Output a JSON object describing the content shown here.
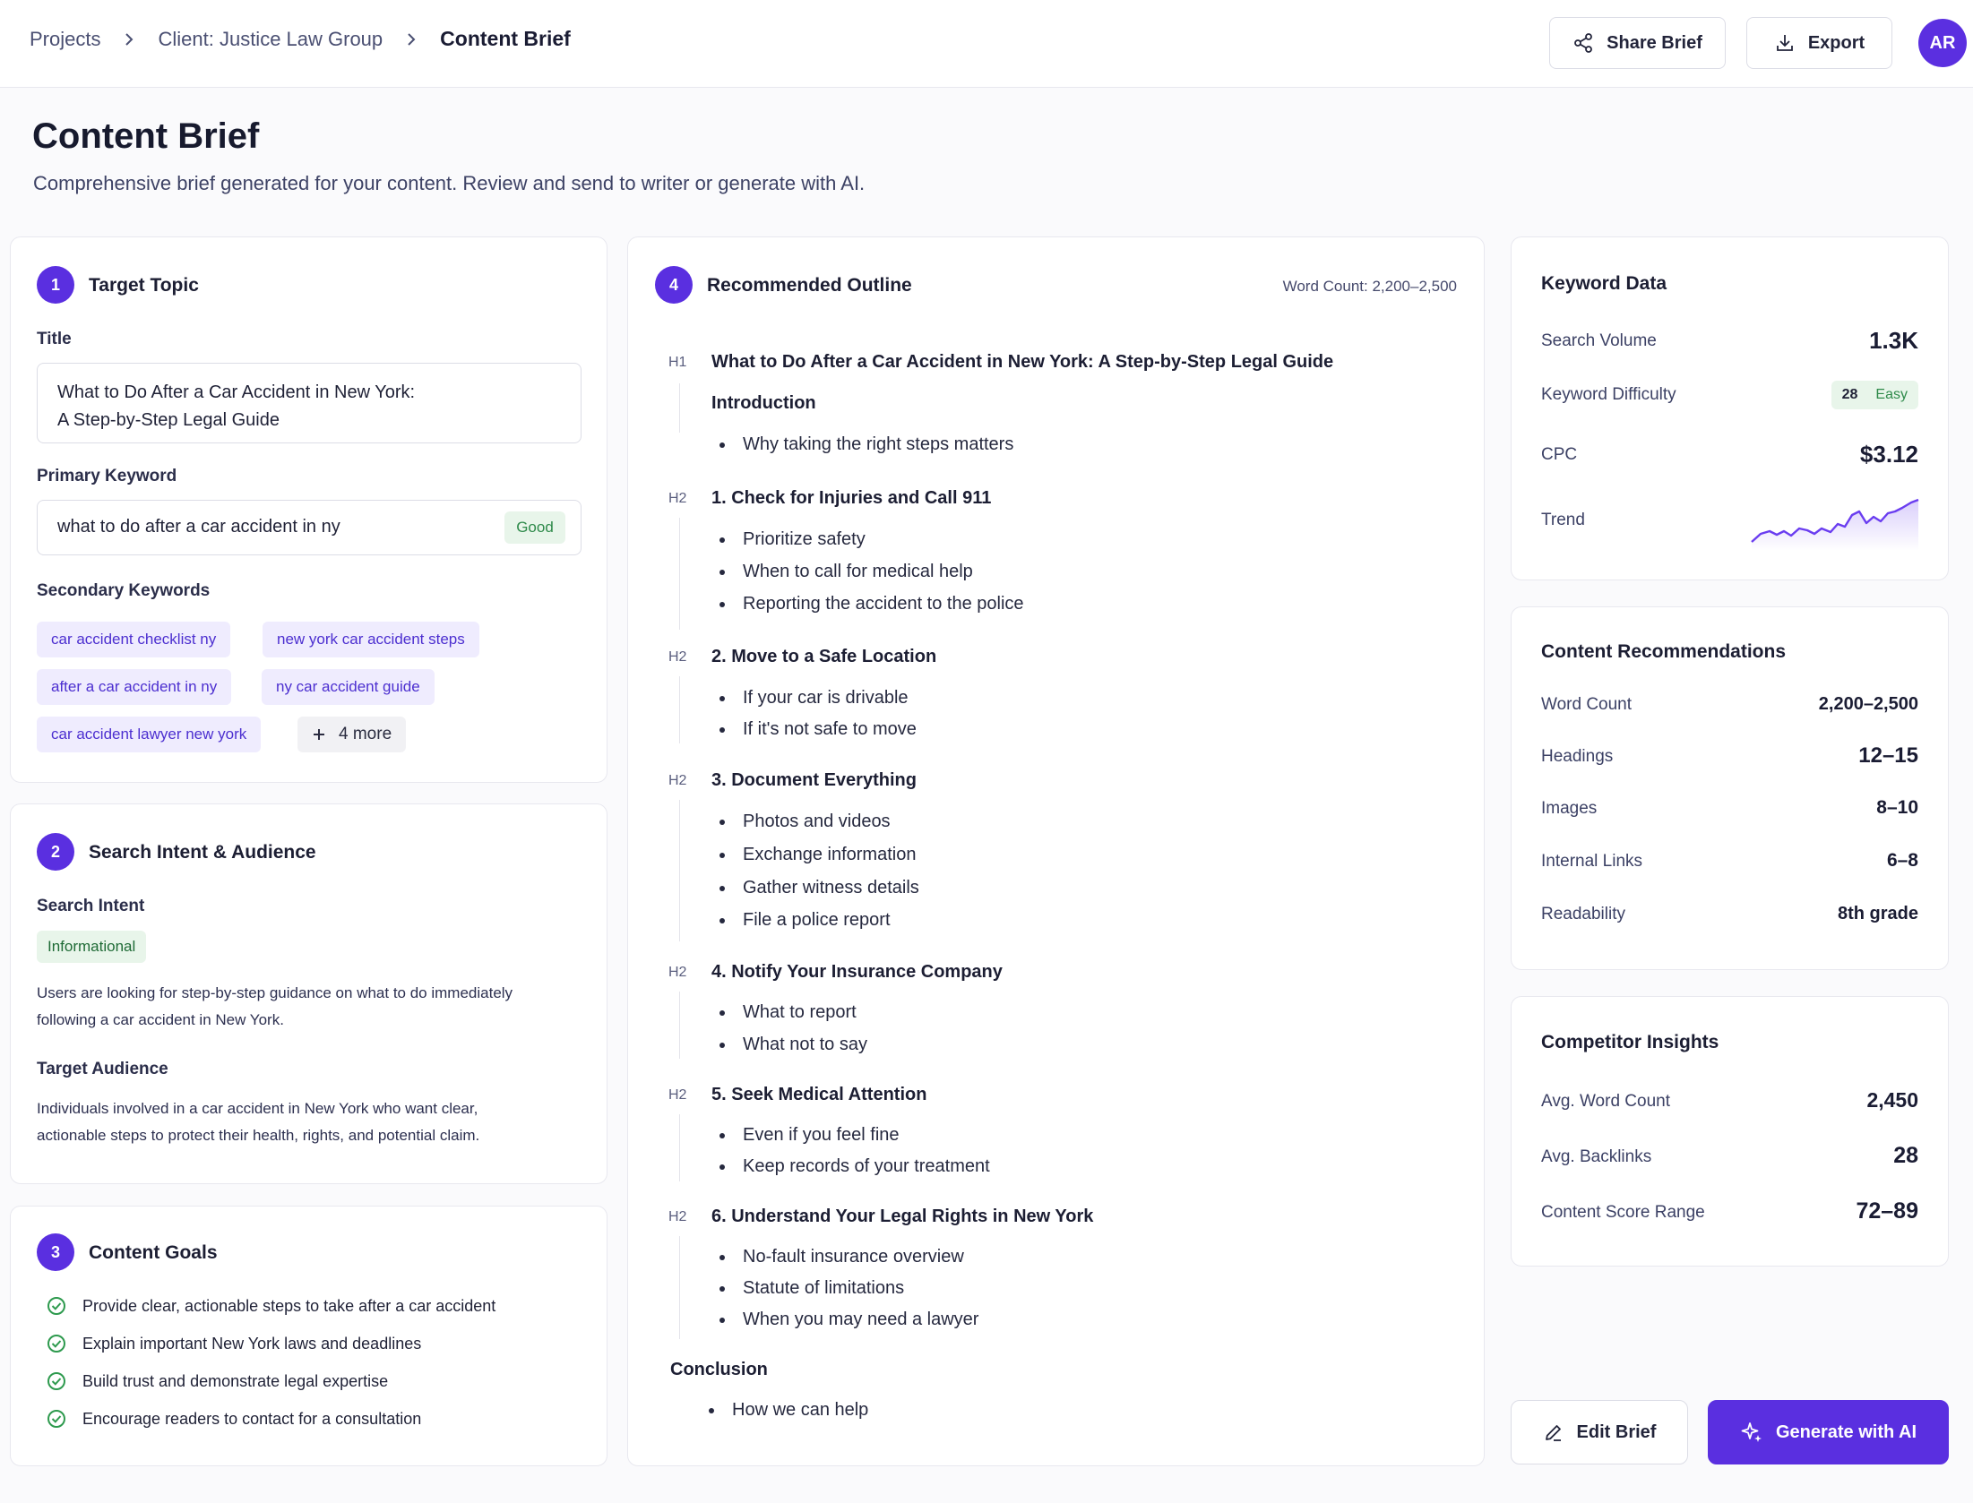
{
  "breadcrumb": {
    "items": [
      "Projects",
      "Client: Justice Law Group"
    ],
    "current": "Content Brief"
  },
  "header_actions": {
    "share_label": "Share Brief",
    "export_label": "Export",
    "avatar_initials": "AR"
  },
  "page": {
    "title": "Content Brief",
    "subtitle": "Comprehensive brief generated for your content. Review and send to writer or generate with AI."
  },
  "target_topic": {
    "number": "1",
    "heading": "Target Topic",
    "title_label": "Title",
    "title_line1": "What to Do After a Car Accident in New York:",
    "title_line2": "A Step-by-Step Legal Guide",
    "primary_label": "Primary Keyword",
    "primary_value": "what to do after a car accident in ny",
    "primary_badge": "Good",
    "secondary_label": "Secondary Keywords",
    "secondary": [
      "car accident checklist ny",
      "new york car accident steps",
      "after a car accident in ny",
      "ny car accident guide",
      "car accident lawyer new york"
    ],
    "more_label": "4 more"
  },
  "search_intent": {
    "number": "2",
    "heading": "Search Intent & Audience",
    "intent_label": "Search Intent",
    "intent_badge": "Informational",
    "intent_text_1": "Users are looking for step-by-step guidance on what to do immediately",
    "intent_text_2": "following a car accident in New York.",
    "audience_label": "Target Audience",
    "audience_text_1": "Individuals involved in a car accident in New York who want clear,",
    "audience_text_2": "actionable steps to protect their health, rights, and potential claim."
  },
  "content_goals": {
    "number": "3",
    "heading": "Content Goals",
    "items": [
      "Provide clear, actionable steps to take after a car accident",
      "Explain important New York laws and deadlines",
      "Build trust and demonstrate legal expertise",
      "Encourage readers to contact for a consultation"
    ]
  },
  "outline": {
    "number": "4",
    "heading": "Recommended Outline",
    "word_count": "Word Count: 2,200–2,500",
    "h1_tag": "H1",
    "h1": "What to Do After a Car Accident in New York: A Step-by-Step Legal Guide",
    "intro": "Introduction",
    "intro_bullets": [
      "Why taking the right steps matters"
    ],
    "h2_tag": "H2",
    "sections": [
      {
        "title": "1. Check for Injuries and Call 911",
        "bullets": [
          "Prioritize safety",
          "When to call for medical help",
          "Reporting the accident to the police"
        ]
      },
      {
        "title": "2. Move to a Safe Location",
        "bullets": [
          "If your car is drivable",
          "If it's not safe to move"
        ]
      },
      {
        "title": "3. Document Everything",
        "bullets": [
          "Photos and videos",
          "Exchange information",
          "Gather witness details",
          "File a police report"
        ]
      },
      {
        "title": "4. Notify Your Insurance Company",
        "bullets": [
          "What to report",
          "What not to say"
        ]
      },
      {
        "title": "5. Seek Medical Attention",
        "bullets": [
          "Even if you feel fine",
          "Keep records of your treatment"
        ]
      },
      {
        "title": "6. Understand Your Legal Rights in New York",
        "bullets": [
          "No-fault insurance overview",
          "Statute of limitations",
          "When you may need a lawyer"
        ]
      }
    ],
    "conclusion": "Conclusion",
    "conclusion_bullets": [
      "How we can help"
    ]
  },
  "keyword_data": {
    "heading": "Keyword Data",
    "search_volume_label": "Search Volume",
    "search_volume": "1.3K",
    "difficulty_label": "Keyword Difficulty",
    "difficulty_value": "28",
    "difficulty_rating": "Easy",
    "cpc_label": "CPC",
    "cpc": "$3.12",
    "trend_label": "Trend",
    "trend_color": "#6a3df0"
  },
  "content_recommendations": {
    "heading": "Content Recommendations",
    "rows": [
      {
        "label": "Word Count",
        "value": "2,200–2,500"
      },
      {
        "label": "Headings",
        "value": "12–15"
      },
      {
        "label": "Images",
        "value": "8–10"
      },
      {
        "label": "Internal Links",
        "value": "6–8"
      },
      {
        "label": "Readability",
        "value": "8th grade"
      }
    ]
  },
  "competitor_insights": {
    "heading": "Competitor Insights",
    "rows": [
      {
        "label": "Avg. Word Count",
        "value": "2,450"
      },
      {
        "label": "Avg. Backlinks",
        "value": "28"
      },
      {
        "label": "Content Score Range",
        "value": "72–89"
      }
    ]
  },
  "footer_actions": {
    "edit_label": "Edit Brief",
    "generate_label": "Generate with AI"
  },
  "colors": {
    "accent": "#5a2fe0",
    "good": "#2e8a4a",
    "good_bg": "#e8f5ea"
  }
}
